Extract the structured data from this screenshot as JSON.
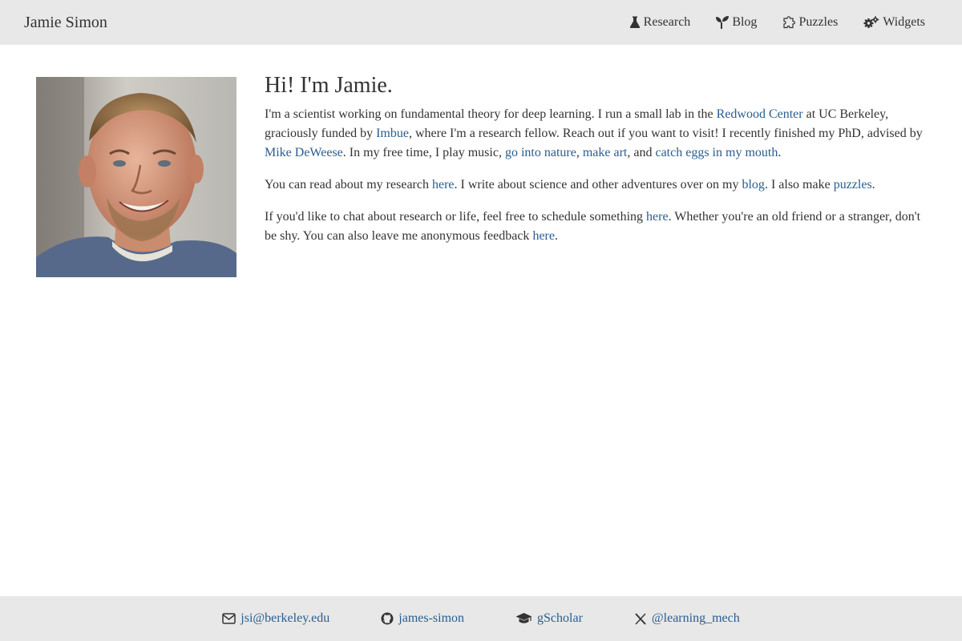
{
  "header": {
    "brand": "Jamie Simon",
    "nav": [
      {
        "label": "Research",
        "icon": "flask-icon"
      },
      {
        "label": "Blog",
        "icon": "seedling-icon"
      },
      {
        "label": "Puzzles",
        "icon": "puzzle-icon"
      },
      {
        "label": "Widgets",
        "icon": "gears-icon"
      }
    ]
  },
  "main": {
    "photo_alt": "Photo of Jamie Simon",
    "headline": "Hi! I'm Jamie.",
    "p1": {
      "t1": "I'm a scientist working on fundamental theory for deep learning. I run a small lab in the ",
      "link_redwood": "Redwood Center",
      "t2": " at UC Berkeley, graciously funded by ",
      "link_imbue": "Imbue",
      "t3": ", where I'm a research fellow. Reach out if you want to visit! I recently finished my PhD, advised by ",
      "link_mike": "Mike DeWeese",
      "t4": ". In my free time, I play music, ",
      "link_nature": "go into nature",
      "t5": ", ",
      "link_art": "make art",
      "t6": ", and ",
      "link_eggs": "catch eggs in my mouth",
      "t7": "."
    },
    "p2": {
      "t1": "You can read about my research ",
      "link_here": "here",
      "t2": ". I write about science and other adventures over on my ",
      "link_blog": "blog",
      "t3": ". I also make ",
      "link_puzzles": "puzzles",
      "t4": "."
    },
    "p3": {
      "t1": "If you'd like to chat about research or life, feel free to schedule something ",
      "link_schedule": "here",
      "t2": ". Whether you're an old friend or a stranger, don't be shy. You can also leave me anonymous feedback ",
      "link_feedback": "here",
      "t3": "."
    }
  },
  "footer": {
    "items": [
      {
        "label": "jsi@berkeley.edu",
        "icon": "envelope-icon"
      },
      {
        "label": "james-simon",
        "icon": "github-icon"
      },
      {
        "label": "gScholar",
        "icon": "graduation-cap-icon"
      },
      {
        "label": "@learning_mech",
        "icon": "x-logo-icon"
      }
    ]
  },
  "colors": {
    "link": "#2a5d8f",
    "bar_bg": "#e8e8e8",
    "text": "#333333"
  }
}
